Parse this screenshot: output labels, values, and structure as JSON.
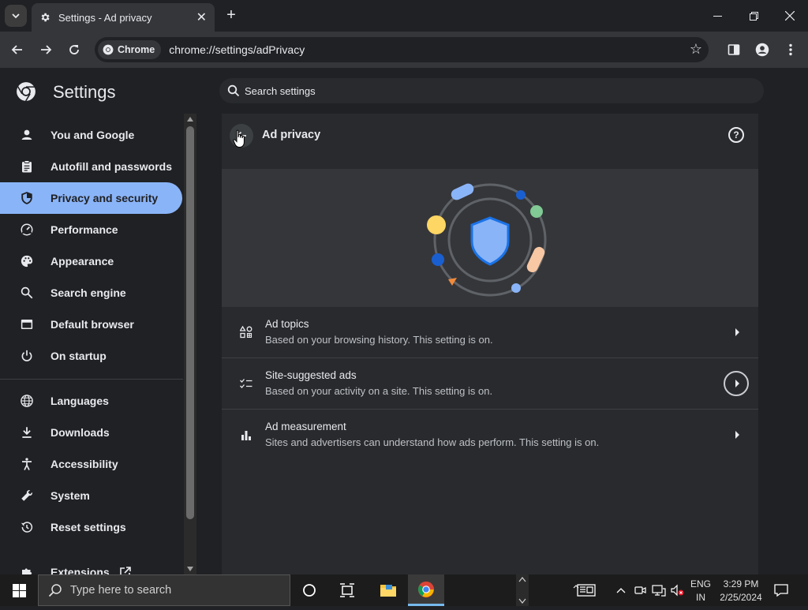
{
  "browser": {
    "tab": {
      "title": "Settings - Ad privacy",
      "close": "✕"
    },
    "new_tab": "+",
    "window_controls": {
      "minimize": "—",
      "restore": "❐",
      "close": "✕"
    },
    "chip_label": "Chrome",
    "url": "chrome://settings/adPrivacy",
    "star": "☆"
  },
  "settings": {
    "title": "Settings",
    "search_placeholder": "Search settings"
  },
  "sidebar": {
    "items": [
      {
        "label": "You and Google",
        "icon": "person-icon"
      },
      {
        "label": "Autofill and passwords",
        "icon": "clipboard-icon"
      },
      {
        "label": "Privacy and security",
        "icon": "shield-icon",
        "active": true
      },
      {
        "label": "Performance",
        "icon": "speedometer-icon"
      },
      {
        "label": "Appearance",
        "icon": "palette-icon"
      },
      {
        "label": "Search engine",
        "icon": "search-icon"
      },
      {
        "label": "Default browser",
        "icon": "browser-icon"
      },
      {
        "label": "On startup",
        "icon": "power-icon"
      },
      {
        "label": "Languages",
        "icon": "globe-icon"
      },
      {
        "label": "Downloads",
        "icon": "download-icon"
      },
      {
        "label": "Accessibility",
        "icon": "accessibility-icon"
      },
      {
        "label": "System",
        "icon": "wrench-icon"
      },
      {
        "label": "Reset settings",
        "icon": "history-icon"
      },
      {
        "label": "Extensions",
        "icon": "puzzle-icon"
      }
    ],
    "accent_color": "#8ab4f8"
  },
  "page": {
    "title": "Ad privacy",
    "rows": [
      {
        "title": "Ad topics",
        "subtitle": "Based on your browsing history. This setting is on."
      },
      {
        "title": "Site-suggested ads",
        "subtitle": "Based on your activity on a site. This setting is on."
      },
      {
        "title": "Ad measurement",
        "subtitle": "Sites and advertisers can understand how ads perform. This setting is on."
      }
    ]
  },
  "taskbar": {
    "search_placeholder": "Type here to search",
    "lang_top": "ENG",
    "lang_bottom": "IN",
    "time": "3:29 PM",
    "date": "2/25/2024"
  }
}
